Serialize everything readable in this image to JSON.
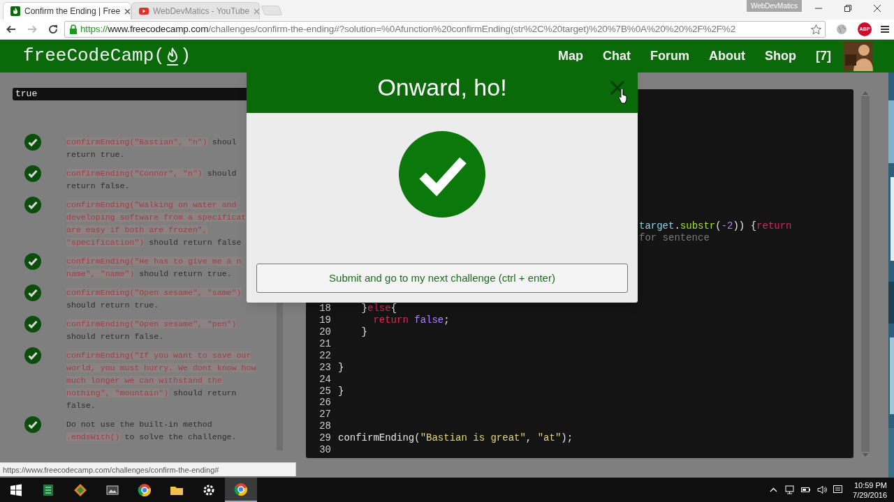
{
  "browser": {
    "tabs": [
      {
        "title": "Confirm the Ending | Free",
        "selected": true,
        "kind": "camp"
      },
      {
        "title": "WebDevMatics - YouTube",
        "selected": false,
        "kind": "video"
      }
    ],
    "profile": "WebDevMatics",
    "url": {
      "scheme": "https://",
      "host": "www.freecodecamp.com",
      "path": "/challenges/confirm-the-ending#?solution=%0Afunction%20confirmEnding(str%2C%20target)%20%7B%0A%20%20%2F%2F%2"
    },
    "extension_badge": "ABP"
  },
  "navbar": {
    "logo": {
      "before": "freeCodeCamp(",
      "after": ")"
    },
    "links": [
      "Map",
      "Chat",
      "Forum",
      "About",
      "Shop"
    ],
    "points": "[7]"
  },
  "output": "true",
  "tests": [
    {
      "passed": true,
      "segments": [
        {
          "kind": "code",
          "text": "confirmEnding(\"Bastian\", \"n\")"
        },
        {
          "kind": "plain",
          "text": " shoul\nreturn true."
        }
      ]
    },
    {
      "passed": true,
      "segments": [
        {
          "kind": "code",
          "text": "confirmEnding(\"Connor\", \"n\")"
        },
        {
          "kind": "plain",
          "text": " should\nreturn false."
        }
      ]
    },
    {
      "passed": true,
      "segments": [
        {
          "kind": "code",
          "text": "confirmEnding(\"Walking on water and\ndeveloping software from a specificat\nare easy if both are frozen\",\n\"specification\")"
        },
        {
          "kind": "plain",
          "text": " should return false"
        }
      ]
    },
    {
      "passed": true,
      "segments": [
        {
          "kind": "code",
          "text": "confirmEnding(\"He has to give me a n\nname\", \"name\")"
        },
        {
          "kind": "plain",
          "text": " should return true."
        }
      ]
    },
    {
      "passed": true,
      "segments": [
        {
          "kind": "code",
          "text": "confirmEnding(\"Open sesame\", \"same\")"
        },
        {
          "kind": "plain",
          "text": "\nshould return true."
        }
      ]
    },
    {
      "passed": true,
      "segments": [
        {
          "kind": "code",
          "text": "confirmEnding(\"Open sesame\", \"pen\")"
        },
        {
          "kind": "plain",
          "text": "\nshould return false."
        }
      ]
    },
    {
      "passed": true,
      "segments": [
        {
          "kind": "code",
          "text": "confirmEnding(\"If you want to save our\nworld, you must hurry. We dont know how\nmuch longer we can withstand the\nnothing\", \"mountain\")"
        },
        {
          "kind": "plain",
          "text": " should return\nfalse."
        }
      ]
    },
    {
      "passed": true,
      "segments": [
        {
          "kind": "plain",
          "text": "Do not use the built-in method\n"
        },
        {
          "kind": "code",
          "text": ".endsWith()"
        },
        {
          "kind": "plain",
          "text": " to solve the challenge."
        }
      ]
    }
  ],
  "editor": {
    "partial_lines": [
      [
        {
          "kind": "variable",
          "text": "target"
        },
        {
          "kind": "plain",
          "text": "."
        },
        {
          "kind": "property",
          "text": "substr"
        },
        {
          "kind": "plain",
          "text": "("
        },
        {
          "kind": "number",
          "text": "-2"
        },
        {
          "kind": "plain",
          "text": ")) {"
        },
        {
          "kind": "keyword",
          "text": "return"
        }
      ],
      [
        {
          "kind": "comment",
          "text": "for sentence"
        }
      ]
    ],
    "lines": [
      {
        "number": "18",
        "tokens": [
          {
            "kind": "plain",
            "text": "    }"
          },
          {
            "kind": "keyword",
            "text": "else"
          },
          {
            "kind": "plain",
            "text": "{"
          }
        ]
      },
      {
        "number": "19",
        "tokens": [
          {
            "kind": "keyword",
            "text": "      return"
          },
          {
            "kind": "atom",
            "text": " false"
          },
          {
            "kind": "plain",
            "text": ";"
          }
        ]
      },
      {
        "number": "20",
        "tokens": [
          {
            "kind": "plain",
            "text": "    }"
          }
        ]
      },
      {
        "number": "21"
      },
      {
        "number": "22"
      },
      {
        "number": "23",
        "tokens": [
          {
            "kind": "plain",
            "text": "}"
          }
        ]
      },
      {
        "number": "24"
      },
      {
        "number": "25",
        "tokens": [
          {
            "kind": "plain",
            "text": "}"
          }
        ]
      },
      {
        "number": "26"
      },
      {
        "number": "27"
      },
      {
        "number": "28"
      },
      {
        "number": "29",
        "tokens": [
          {
            "kind": "plain",
            "text": "confirmEnding("
          },
          {
            "kind": "string",
            "text": "\"Bastian is great\""
          },
          {
            "kind": "plain",
            "text": ", "
          },
          {
            "kind": "string",
            "text": "\"at\""
          },
          {
            "kind": "plain",
            "text": ");"
          }
        ]
      },
      {
        "number": "30"
      }
    ]
  },
  "modal": {
    "title": "Onward, ho!",
    "button": "Submit and go to my next challenge (ctrl + enter)"
  },
  "status_link": "https://www.freecodecamp.com/challenges/confirm-the-ending#",
  "taskbar": {
    "time": "10:59 PM",
    "date": "7/29/2016"
  }
}
